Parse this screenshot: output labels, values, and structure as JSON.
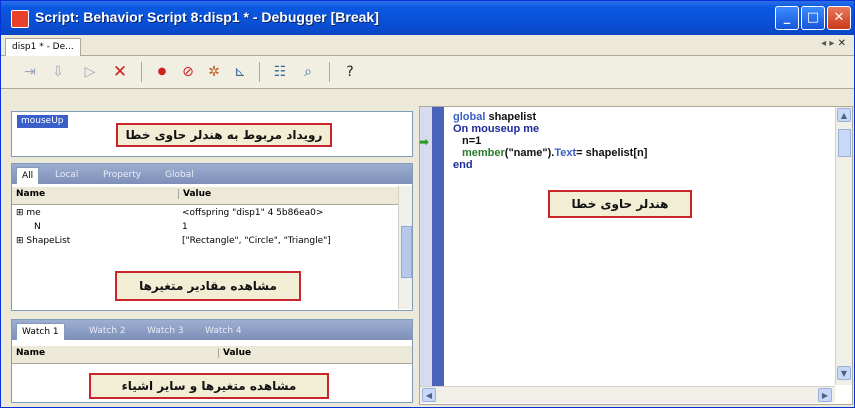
{
  "window": {
    "title": "Script: Behavior Script 8:disp1 * - Debugger [Break]",
    "buttons": {
      "minimize": "_",
      "maximize": "□",
      "close": "✕"
    }
  },
  "doc_tab": {
    "label": "disp1 * - De..."
  },
  "toolbar": {
    "icons": [
      "step-over-icon",
      "step-into-icon",
      "run-icon",
      "stop-icon",
      "breakpoint-icon",
      "ignore-breakpoints-icon",
      "watch-expression-icon",
      "inspector-icon",
      "script-icon",
      "find-icon",
      "help-icon"
    ]
  },
  "event_panel": {
    "selected": "mouseUp"
  },
  "annotations": {
    "event": "رویداد مربوط به هندلر حاوی خطا",
    "handler": "هندلر حاوی خطا",
    "variables": "مشاهده مقادیر متغیرها",
    "watch": "مشاهده متغیرها و سایر اشیاء"
  },
  "variables_panel": {
    "tabs": [
      "All",
      "Local",
      "Property",
      "Global"
    ],
    "columns": [
      "Name",
      "Value"
    ],
    "rows": [
      {
        "name": "⊞ me",
        "value": "<offspring \"disp1\" 4 5b86ea0>"
      },
      {
        "name": "N",
        "value": "1"
      },
      {
        "name": "⊞ ShapeList",
        "value": "[\"Rectangle\", \"Circle\", \"Triangle\"]"
      }
    ]
  },
  "watch_panel": {
    "tabs": [
      "Watch 1",
      "Watch 2",
      "Watch 3",
      "Watch 4"
    ],
    "columns": [
      "Name",
      "Value"
    ]
  },
  "script": {
    "line1_kw": "global",
    "line1_rest": " shapelist",
    "line2_kw": "On mouseup me",
    "line3": "n=1",
    "line4_a": "member",
    "line4_b": "(\"name\").",
    "line4_c": "Text",
    "line4_d": "= shapelist[n]",
    "line5": "end"
  },
  "colors": {
    "annotation_border": "#c9252b",
    "annotation_fill": "#f2eed6",
    "title_bar": "#0a4fd3",
    "tab_strip": "#7d8fb8",
    "current_line_arrow": "#2a9a2a"
  }
}
